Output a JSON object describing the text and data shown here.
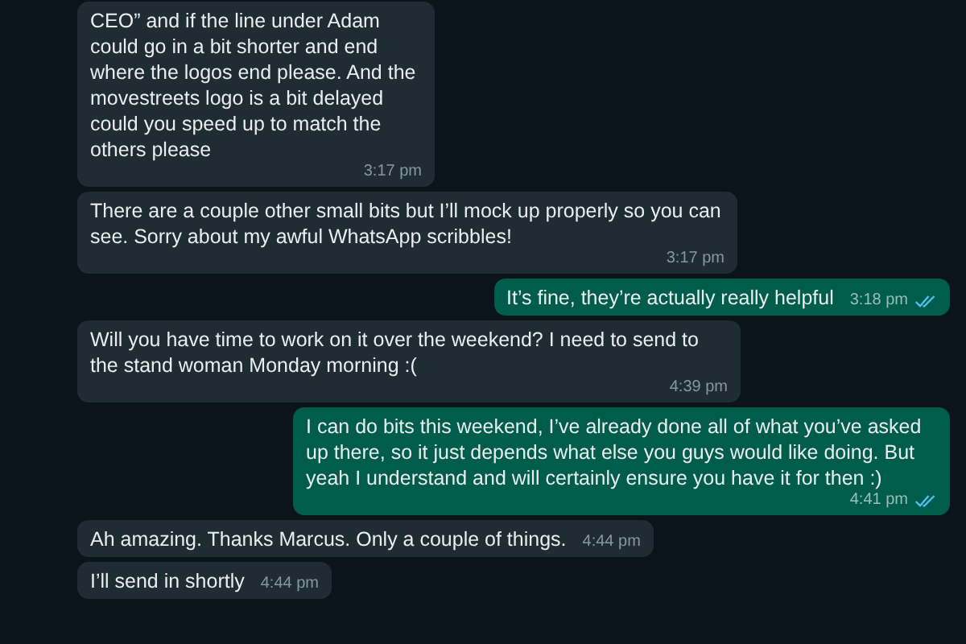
{
  "messages": [
    {
      "kind": "incoming",
      "text": "CEO” and if the line under Adam could go in a bit shorter and end where the logos end please. And the movestreets logo is a bit delayed could you speed up to match the others please",
      "time": "3:17 pm"
    },
    {
      "kind": "incoming",
      "text": "There are a couple other small bits but I’ll mock up properly so you can see. Sorry about my awful WhatsApp scribbles!",
      "time": "3:17 pm"
    },
    {
      "kind": "outgoing",
      "text": "It’s fine, they’re actually really helpful",
      "time": "3:18 pm",
      "read": true
    },
    {
      "kind": "incoming",
      "text": "Will you have time to work on it over the weekend? I need to send to the stand woman Monday morning :(",
      "time": "4:39 pm"
    },
    {
      "kind": "outgoing",
      "text": "I can do bits this weekend, I’ve already done all of what you’ve asked up there, so it just depends what else you guys would like doing. But yeah I understand and will certainly ensure you have it for then :)",
      "time": "4:41 pm",
      "read": true
    },
    {
      "kind": "incoming",
      "text": "Ah amazing. Thanks Marcus. Only a couple of things.",
      "time": "4:44 pm"
    },
    {
      "kind": "incoming",
      "text": "I’ll send in shortly",
      "time": "4:44 pm"
    }
  ]
}
